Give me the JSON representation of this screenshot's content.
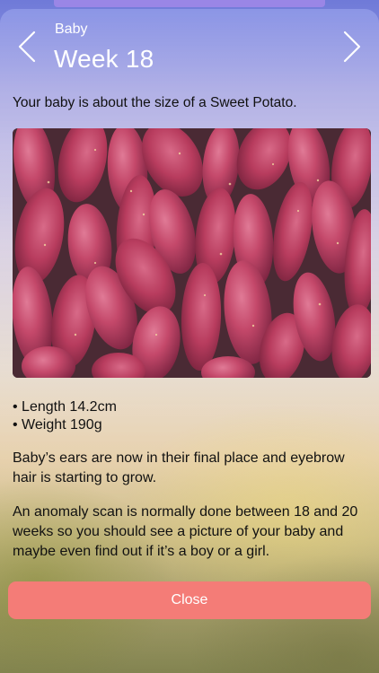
{
  "header": {
    "section_label": "Baby",
    "title": "Week 18",
    "prev_icon": "chevron-left-icon",
    "next_icon": "chevron-right-icon"
  },
  "content": {
    "intro": "Your baby is about the size of a Sweet Potato.",
    "facts": [
      "• Length 14.2cm",
      "• Weight 190g"
    ],
    "paragraph_1": "Baby’s ears are now in their final place and eyebrow hair is starting to grow.",
    "paragraph_2": "An anomaly scan is normally done between 18 and 20 weeks so you should see a picture of your baby and maybe even find out if it’s a boy or a girl."
  },
  "footer": {
    "close_label": "Close"
  },
  "colors": {
    "accent_button": "#f47c77",
    "header_text": "#ffffff",
    "sweet_potato": "#c44a68"
  }
}
